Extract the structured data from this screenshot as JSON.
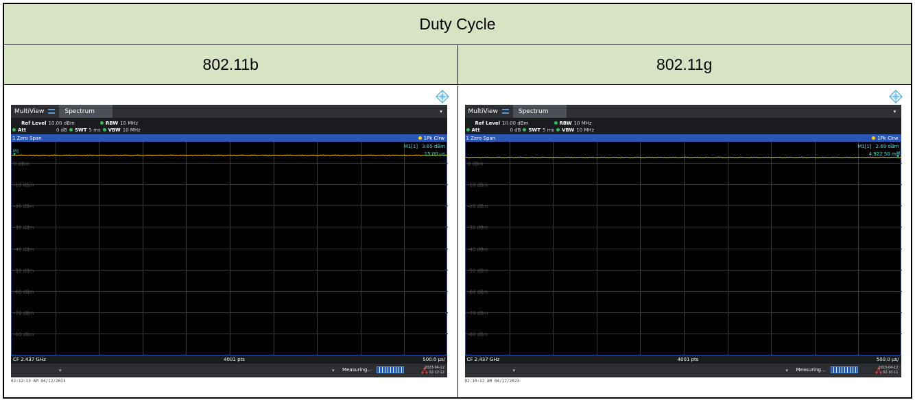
{
  "table": {
    "title": "Duty Cycle",
    "columns": [
      "802.11b",
      "802.11g"
    ]
  },
  "panels": [
    {
      "tab_multiview": "MultiView",
      "tab_spectrum": "Spectrum",
      "ref_level_label": "Ref Level",
      "ref_level_value": "10.00 dBm",
      "att_label": "Att",
      "att_value": "0 dB",
      "swt_label": "SWT",
      "swt_value": "5 ms",
      "rbw_label": "RBW",
      "rbw_value": "10 MHz",
      "vbw_label": "VBW",
      "vbw_value": "10 MHz",
      "trace_name": "1 Zero Span",
      "trace_indicator": "1Pk Clrw",
      "marker_name": "M1[1]",
      "marker_level": "3.65 dBm",
      "marker_time": "15.00 µs",
      "marker_flag": "M1",
      "y_labels": [
        "0 dBm",
        "-10 dBm",
        "-20 dBm",
        "-30 dBm",
        "-40 dBm",
        "-50 dBm",
        "-60 dBm",
        "-70 dBm",
        "-80 dBm"
      ],
      "cf": "CF 2.437 GHz",
      "points": "4001 pts",
      "div": "500.0 µs/",
      "measuring": "Measuring...",
      "date": "2023-04-12",
      "time": "02:12:12",
      "capture_timestamp": "02:12:13 AM  04/12/2023"
    },
    {
      "tab_multiview": "MultiView",
      "tab_spectrum": "Spectrum",
      "ref_level_label": "Ref Level",
      "ref_level_value": "10.00 dBm",
      "att_label": "Att",
      "att_value": "0 dB",
      "swt_label": "SWT",
      "swt_value": "5 ms",
      "rbw_label": "RBW",
      "rbw_value": "10 MHz",
      "vbw_label": "VBW",
      "vbw_value": "10 MHz",
      "trace_name": "1 Zero Span",
      "trace_indicator": "1Pk Clrw",
      "marker_name": "M1[1]",
      "marker_level": "2.69 dBm",
      "marker_time": "4.922 50 ms",
      "marker_flag": "M1",
      "y_labels": [
        "0 dBm",
        "-10 dBm",
        "-20 dBm",
        "-30 dBm",
        "-40 dBm",
        "-50 dBm",
        "-60 dBm",
        "-70 dBm",
        "-80 dBm"
      ],
      "cf": "CF 2.437 GHz",
      "points": "4001 pts",
      "div": "500.0 µs/",
      "measuring": "Measuring...",
      "date": "2023-04-12",
      "time": "02:10:11",
      "capture_timestamp": "02:10:12 AM  04/12/2023"
    }
  ],
  "colors": {
    "header_bg": "#d8e3c3",
    "trace": "#ffd400",
    "marker": "#33e0e6",
    "status_dot": "#33c35a",
    "trace_header": "#2a55b5"
  }
}
